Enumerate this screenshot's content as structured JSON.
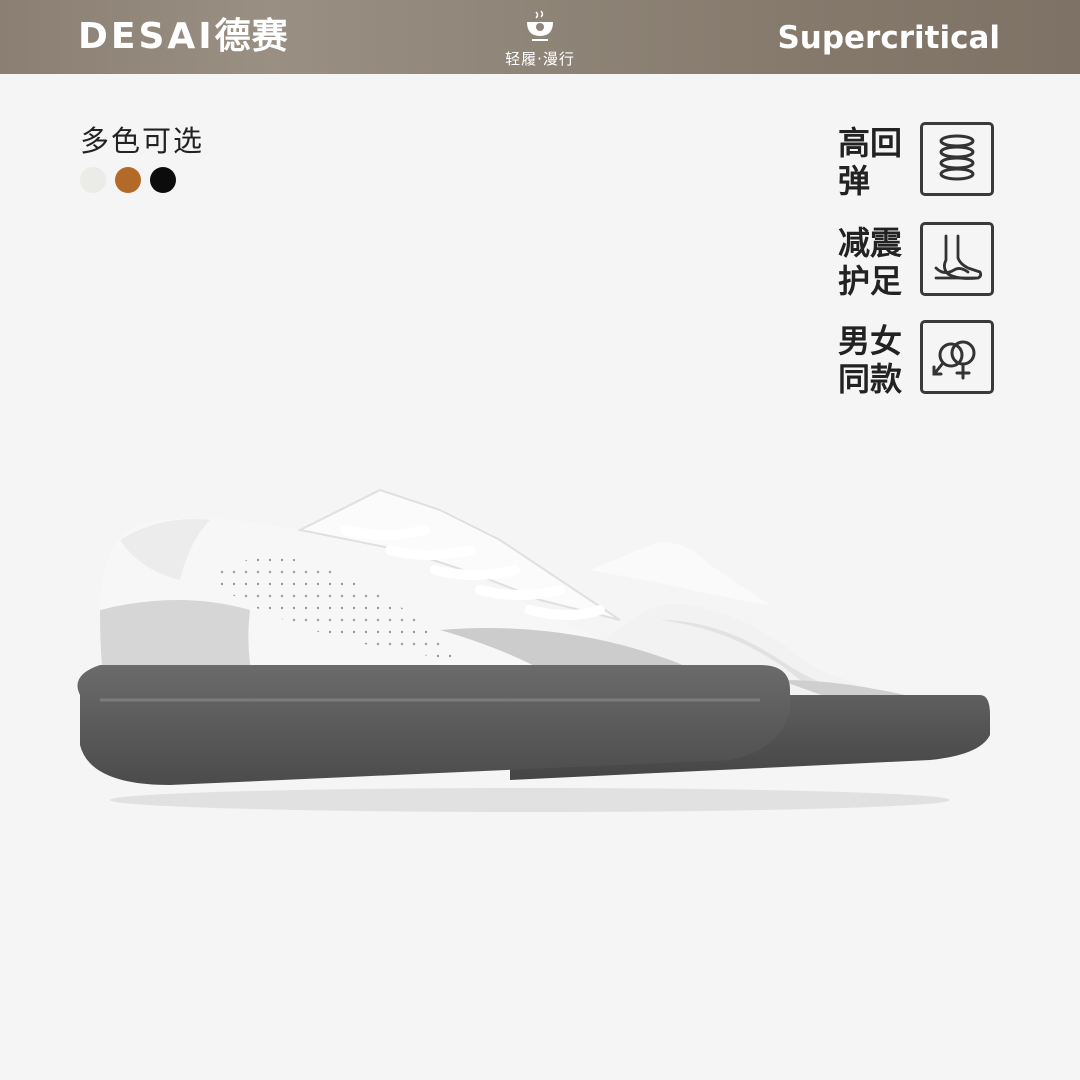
{
  "header": {
    "brand_latin": "DESAI",
    "brand_cn": "德赛",
    "slogan": "轻履·漫行",
    "right_title": "Supercritical"
  },
  "colors": {
    "title": "多色可选",
    "swatches": [
      "#ebebe8",
      "#b36a28",
      "#0c0c0c"
    ]
  },
  "features": [
    {
      "line1": "高回",
      "line2": "弹",
      "icon": "spring-icon"
    },
    {
      "line1": "减震",
      "line2": "护足",
      "icon": "foot-icon"
    },
    {
      "line1": "男女",
      "line2": "同款",
      "icon": "gender-icon"
    }
  ],
  "product": {
    "image": "white-sneakers-pair-image"
  }
}
